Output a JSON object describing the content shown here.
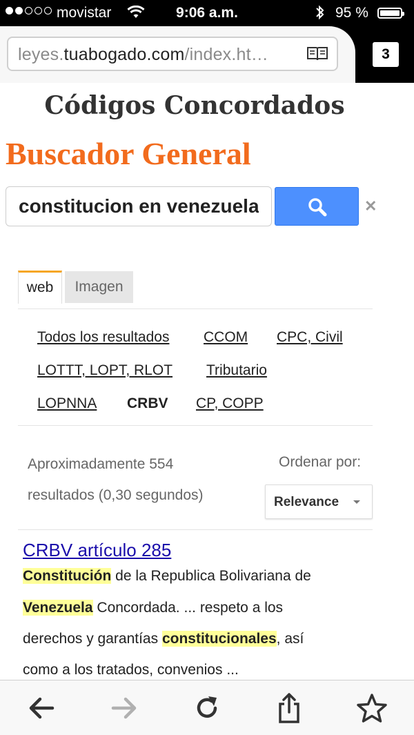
{
  "status_bar": {
    "carrier": "movistar",
    "time": "9:06 a.m.",
    "battery": "95 %",
    "signal_icon": "signal-dots-icon",
    "wifi_icon": "wifi-icon",
    "bluetooth_icon": "bluetooth-icon"
  },
  "browser": {
    "url_prefix": "leyes.",
    "url_domain": "tuabogado.com",
    "url_suffix": "/index.ht…",
    "tab_count": "3"
  },
  "header": {
    "title": "Códigos Concordados",
    "subtitle": "Buscador General"
  },
  "search": {
    "query": "constitucion en venezuela"
  },
  "tabs": [
    {
      "label": "web",
      "active": true
    },
    {
      "label": "Imagen",
      "active": false
    }
  ],
  "refinements": [
    "Todos los resultados",
    "CCOM",
    "CPC, Civil",
    "LOTTT, LOPT, RLOT",
    "Tributario",
    "LOPNNA",
    "CRBV",
    "CP, COPP"
  ],
  "results_info": {
    "count_line1": "Aproximadamente 554",
    "count_line2": "resultados (0,30 segundos)",
    "order_label": "Ordenar por:",
    "order_value": "Relevance"
  },
  "results": [
    {
      "title": "CRBV artículo 285",
      "snippet": {
        "l1_hl": "Constitución",
        "l1_rest": " de la Republica Bolivariana de",
        "l2_hl": "Venezuela",
        "l2_rest": " Concordada. ... respeto a los",
        "l3_pre": "derechos y garantías ",
        "l3_hl": "constitucionales",
        "l3_rest": ", así",
        "l4": "como a los tratados, convenios ..."
      }
    }
  ],
  "bottom_bar": [
    "back-icon",
    "forward-icon",
    "reload-icon",
    "share-icon",
    "bookmark-star-icon"
  ],
  "colors": {
    "accent_orange": "#f26b1d",
    "search_button": "#4d90fe",
    "link_blue": "#1a0dab",
    "highlight": "#ffff99",
    "tab_accent": "#f6a623"
  }
}
